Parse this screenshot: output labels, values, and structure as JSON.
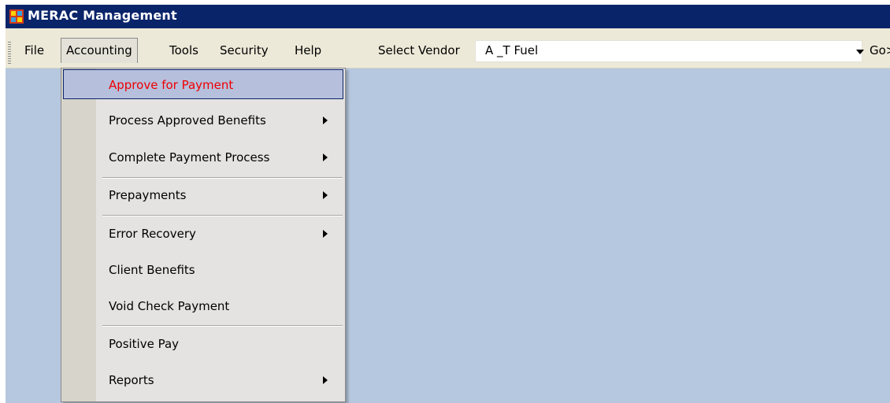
{
  "window": {
    "title": "MERAC Management",
    "icon": "app-window-icon"
  },
  "menubar": {
    "items": [
      {
        "label": "File",
        "open": false
      },
      {
        "label": "Accounting",
        "open": true
      },
      {
        "label": "Tools",
        "open": false
      },
      {
        "label": "Security",
        "open": false
      },
      {
        "label": "Help",
        "open": false
      }
    ],
    "vendor_label": "Select Vendor",
    "vendor_value": "A _T Fuel",
    "go_label": "Go>"
  },
  "accounting_menu": {
    "items": [
      {
        "label": "Approve for Payment",
        "submenu": false,
        "selected": true
      },
      {
        "label": "Process Approved Benefits",
        "submenu": true
      },
      {
        "label": "Complete Payment Process",
        "submenu": true
      },
      {
        "label": "Prepayments",
        "submenu": true
      },
      {
        "label": "Error Recovery",
        "submenu": true
      },
      {
        "label": "Client Benefits",
        "submenu": false
      },
      {
        "label": "Void Check Payment",
        "submenu": false
      },
      {
        "label": "Positive Pay",
        "submenu": false
      },
      {
        "label": "Reports",
        "submenu": true
      }
    ]
  },
  "colors": {
    "titlebar": "#0a246a",
    "workspace": "#b6c8df",
    "selected_text": "#ee0000",
    "selected_bg": "#b6bfdc"
  }
}
